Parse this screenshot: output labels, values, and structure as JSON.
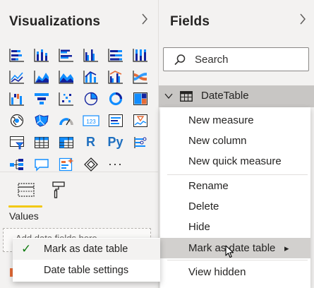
{
  "visualizations": {
    "title": "Visualizations",
    "values_label": "Values",
    "well_placeholder": "Add data fields here",
    "icons": [
      "stacked-bar-chart",
      "stacked-column-chart",
      "clustered-bar-chart",
      "clustered-column-chart",
      "100-stacked-bar-chart",
      "100-stacked-column-chart",
      "line-chart",
      "area-chart",
      "stacked-area-chart",
      "line-and-stacked-column-chart",
      "line-and-clustered-column-chart",
      "ribbon-chart",
      "waterfall-chart",
      "funnel-chart",
      "scatter-chart",
      "pie-chart",
      "donut-chart",
      "treemap",
      "map",
      "filled-map",
      "gauge",
      "card",
      "multi-row-card",
      "kpi",
      "slicer",
      "table",
      "r-script-visual",
      "python-visual",
      "key-influencers",
      "decomposition-tree",
      "qa-visual",
      "smart-narrative",
      "power-apps",
      "more-visuals"
    ],
    "r_glyph": "R",
    "py_glyph": "Py",
    "card_glyph": "123",
    "more_glyph": "···"
  },
  "fields": {
    "title": "Fields",
    "search_placeholder": "Search",
    "table_name": "DateTable"
  },
  "context_menu": {
    "items": [
      "New measure",
      "New column",
      "New quick measure",
      "Rename",
      "Delete",
      "Hide",
      "Mark as date table",
      "View hidden"
    ],
    "submenu_arrow": "▸"
  },
  "submenu": {
    "items": [
      "Mark as date table",
      "Date table settings"
    ],
    "checked_mark": "✓"
  },
  "colors": {
    "accent_blue": "#118dff",
    "dark_blue": "#12239e",
    "orange": "#e66c37",
    "yellow_tab": "#f2c811",
    "check_green": "#107c10"
  }
}
